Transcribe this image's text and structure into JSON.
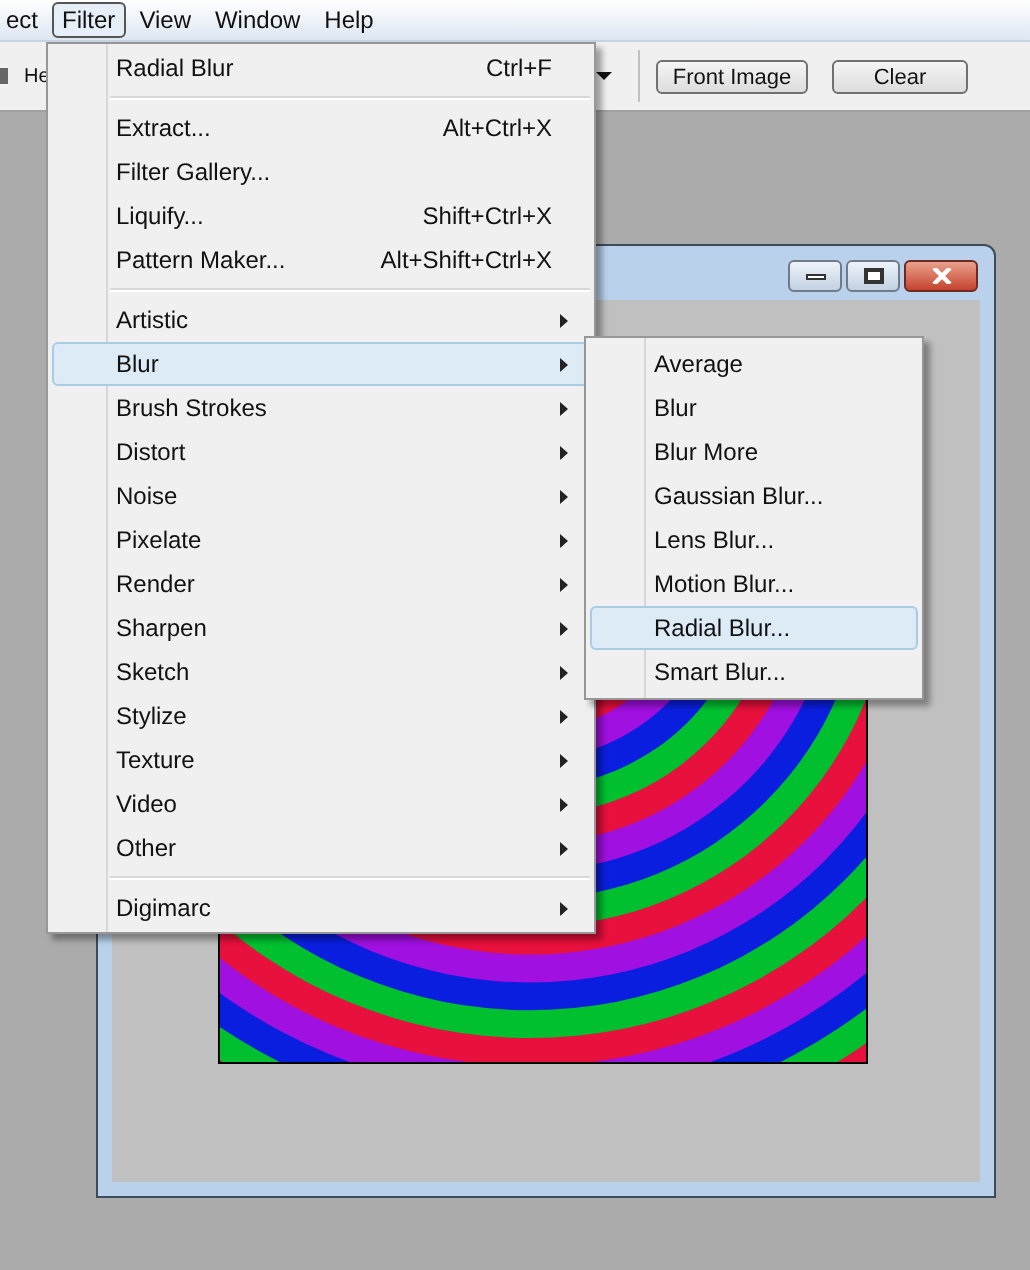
{
  "menubar": [
    {
      "label": "ect",
      "selected": false
    },
    {
      "label": "Filter",
      "selected": true
    },
    {
      "label": "View",
      "selected": false
    },
    {
      "label": "Window",
      "selected": false
    },
    {
      "label": "Help",
      "selected": false
    }
  ],
  "toolbar": {
    "label": "He",
    "buttons": [
      "Front Image",
      "Clear"
    ]
  },
  "filter_menu": {
    "groups": [
      [
        {
          "label": "Radial Blur",
          "shortcut": "Ctrl+F",
          "submenu": false,
          "selected": false
        }
      ],
      [
        {
          "label": "Extract...",
          "shortcut": "Alt+Ctrl+X",
          "submenu": false,
          "selected": false
        },
        {
          "label": "Filter Gallery...",
          "submenu": false,
          "selected": false
        },
        {
          "label": "Liquify...",
          "shortcut": "Shift+Ctrl+X",
          "submenu": false,
          "selected": false
        },
        {
          "label": "Pattern Maker...",
          "shortcut": "Alt+Shift+Ctrl+X",
          "submenu": false,
          "selected": false
        }
      ],
      [
        {
          "label": "Artistic",
          "submenu": true,
          "selected": false
        },
        {
          "label": "Blur",
          "submenu": true,
          "selected": true
        },
        {
          "label": "Brush Strokes",
          "submenu": true,
          "selected": false
        },
        {
          "label": "Distort",
          "submenu": true,
          "selected": false
        },
        {
          "label": "Noise",
          "submenu": true,
          "selected": false
        },
        {
          "label": "Pixelate",
          "submenu": true,
          "selected": false
        },
        {
          "label": "Render",
          "submenu": true,
          "selected": false
        },
        {
          "label": "Sharpen",
          "submenu": true,
          "selected": false
        },
        {
          "label": "Sketch",
          "submenu": true,
          "selected": false
        },
        {
          "label": "Stylize",
          "submenu": true,
          "selected": false
        },
        {
          "label": "Texture",
          "submenu": true,
          "selected": false
        },
        {
          "label": "Video",
          "submenu": true,
          "selected": false
        },
        {
          "label": "Other",
          "submenu": true,
          "selected": false
        }
      ],
      [
        {
          "label": "Digimarc",
          "submenu": true,
          "selected": false
        }
      ]
    ]
  },
  "blur_submenu": [
    {
      "label": "Average",
      "selected": false
    },
    {
      "label": "Blur",
      "selected": false
    },
    {
      "label": "Blur More",
      "selected": false
    },
    {
      "label": "Gaussian Blur...",
      "selected": false
    },
    {
      "label": "Lens Blur...",
      "selected": false
    },
    {
      "label": "Motion Blur...",
      "selected": false
    },
    {
      "label": "Radial Blur...",
      "selected": true
    },
    {
      "label": "Smart Blur...",
      "selected": false
    }
  ]
}
